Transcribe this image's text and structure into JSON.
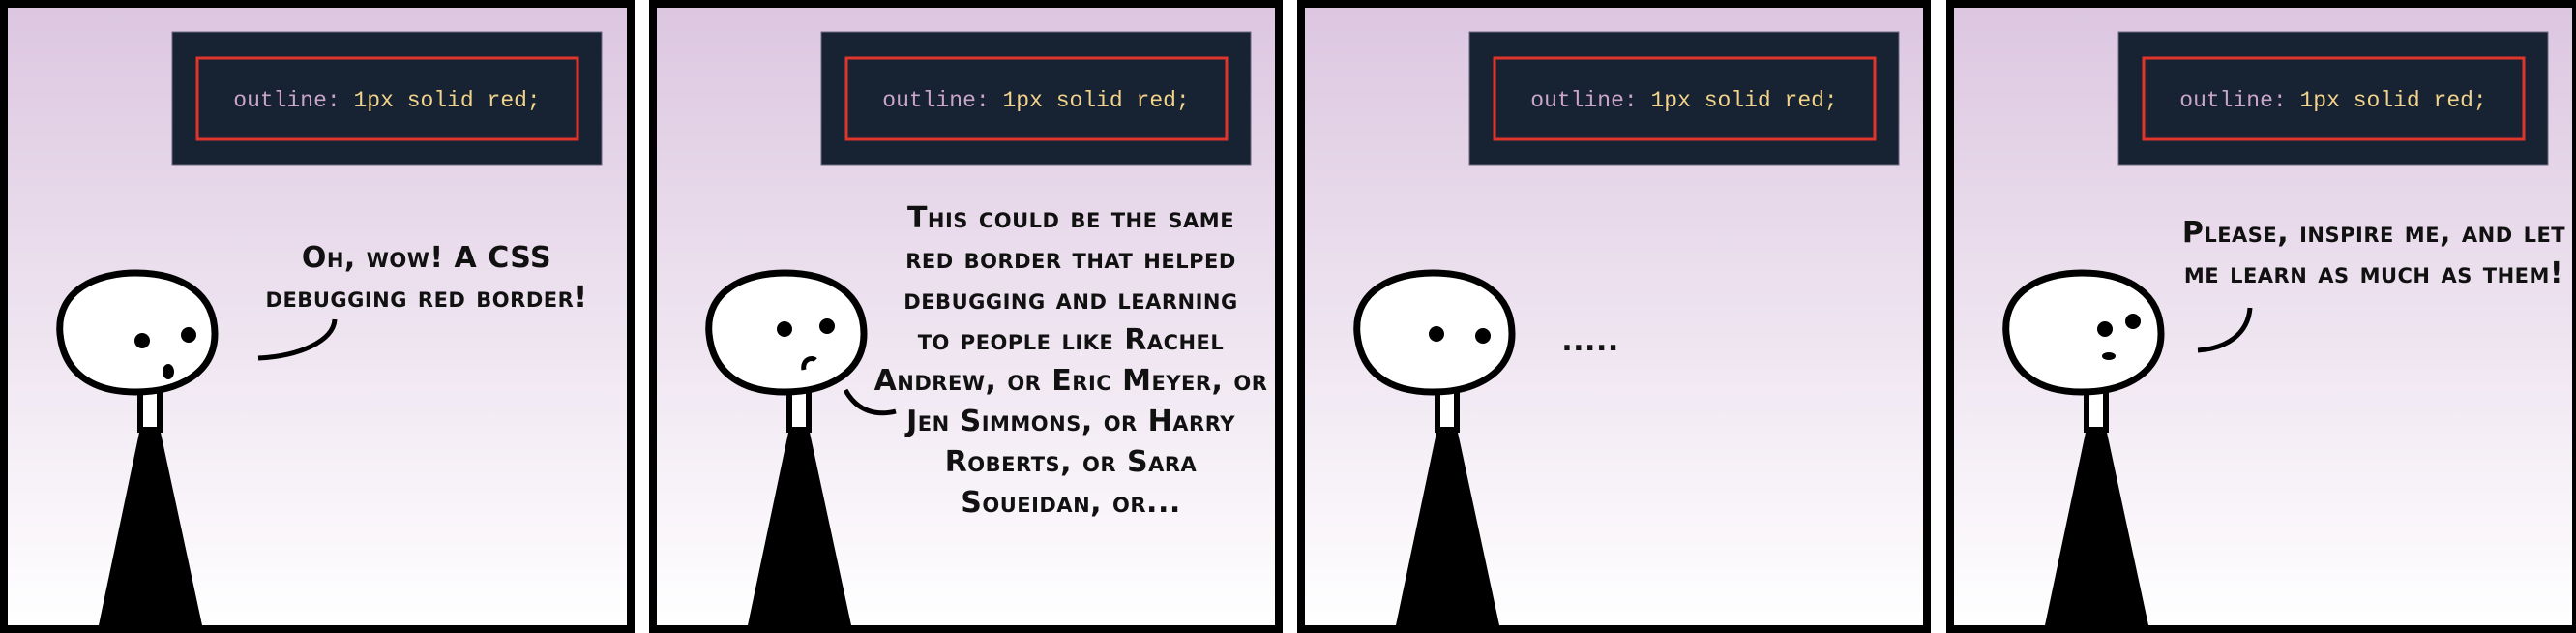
{
  "colors": {
    "code_bg": "#172233",
    "outline": "#e0352b",
    "bg_top": "#dcc6e0",
    "bg_bottom": "#ffffff"
  },
  "panels": [
    {
      "code": {
        "property": "outline:",
        "value": "1px solid red;"
      },
      "speech": [
        "Oh, wow! A CSS",
        "debugging red border!"
      ],
      "expression": "surprised"
    },
    {
      "code": {
        "property": "outline:",
        "value": "1px solid red;"
      },
      "speech": [
        "This could be the same",
        "red border that helped",
        "debugging and learning",
        "to people like Rachel",
        "Andrew, or Eric Meyer, or",
        "Jen Simmons, or Harry",
        "Roberts, or Sara",
        "Soueidan, or..."
      ],
      "expression": "thinking"
    },
    {
      "code": {
        "property": "outline:",
        "value": "1px solid red;"
      },
      "speech": [
        "....."
      ],
      "expression": "silent"
    },
    {
      "code": {
        "property": "outline:",
        "value": "1px solid red;"
      },
      "speech": [
        "Please, inspire me, and let",
        "me learn as much as them!"
      ],
      "expression": "hopeful"
    }
  ]
}
